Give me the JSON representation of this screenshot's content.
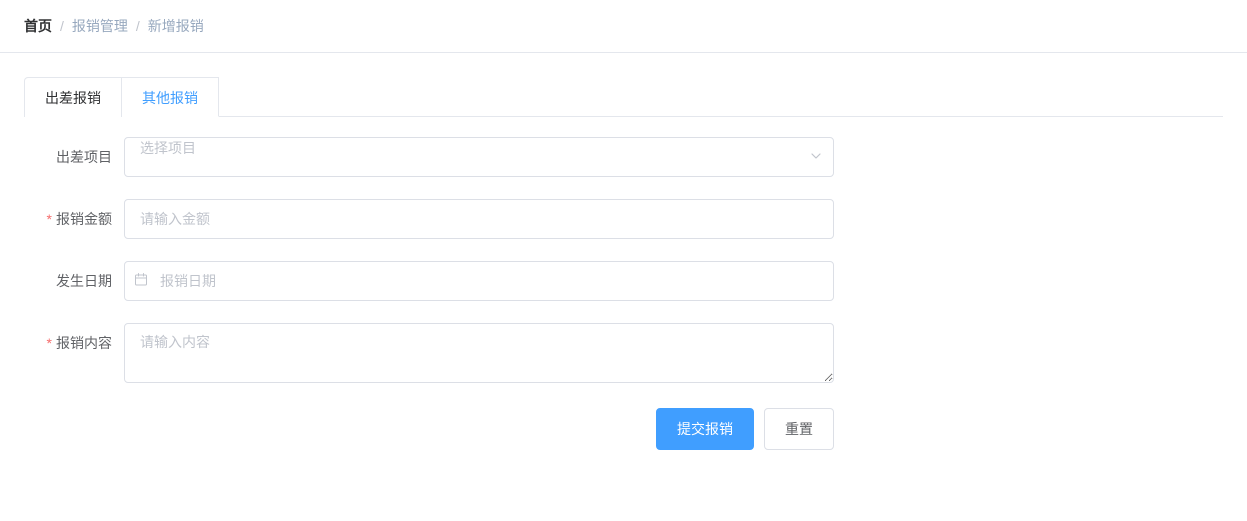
{
  "breadcrumb": {
    "home": "首页",
    "level1": "报销管理",
    "level2": "新增报销"
  },
  "tabs": {
    "travel": "出差报销",
    "other": "其他报销"
  },
  "form": {
    "project": {
      "label": "出差项目",
      "placeholder": "选择项目"
    },
    "amount": {
      "label": "报销金额",
      "placeholder": "请输入金额"
    },
    "date": {
      "label": "发生日期",
      "placeholder": "报销日期"
    },
    "content": {
      "label": "报销内容",
      "placeholder": "请输入内容"
    }
  },
  "actions": {
    "submit": "提交报销",
    "reset": "重置"
  }
}
